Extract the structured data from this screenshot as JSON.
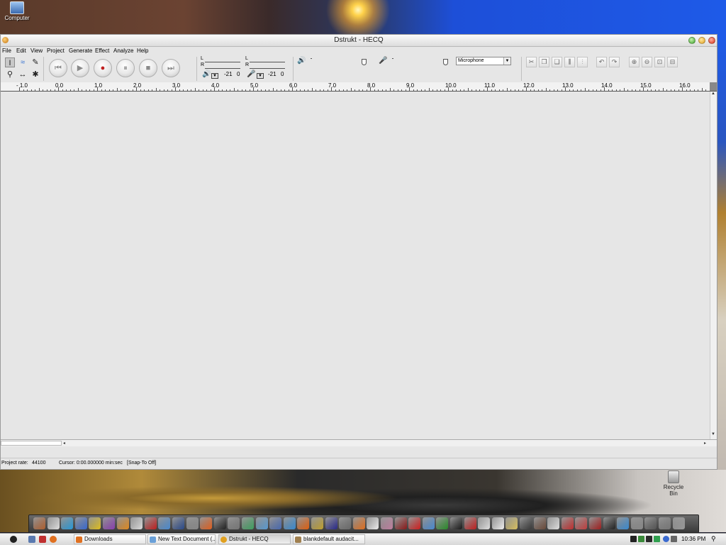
{
  "desktop": {
    "computer_icon_label": "Computer",
    "recycle_bin_label": "Recycle Bin"
  },
  "window": {
    "title": "Dstrukt - HECQ"
  },
  "menu": [
    "File",
    "Edit",
    "View",
    "Project",
    "Generate",
    "Effect",
    "Analyze",
    "Help"
  ],
  "meters": {
    "channel_left": "L",
    "channel_right": "R",
    "playback_level_db": "-21",
    "playback_level_zero": "0",
    "record_level_db": "-21",
    "record_level_zero": "0"
  },
  "mixer": {
    "input_device": "Microphone"
  },
  "ruler": {
    "labels": [
      "- 1.0",
      "0.0",
      "1.0",
      "2.0",
      "3.0",
      "4.0",
      "5.0",
      "6.0",
      "7.0",
      "8.0",
      "9.0",
      "10.0",
      "11.0",
      "12.0",
      "13.0",
      "14.0",
      "15.0",
      "16.0"
    ]
  },
  "status": {
    "project_rate_label": "Project rate:",
    "project_rate_value": "44100",
    "cursor_text": "Cursor: 0:00.000000 min:sec",
    "snap_text": "[Snap-To Off]"
  },
  "taskbar": {
    "tasks": [
      "Downloads",
      "New Text Document (...",
      "Dstrukt - HECQ",
      "blankdefault audacit..."
    ],
    "clock": "10:36 PM"
  },
  "colors": {
    "window_bg": "#e6e6e6",
    "record_red": "#c02020",
    "titlebar_close": "#d83018",
    "titlebar_min": "#3ea22a",
    "titlebar_max": "#e0a020"
  }
}
